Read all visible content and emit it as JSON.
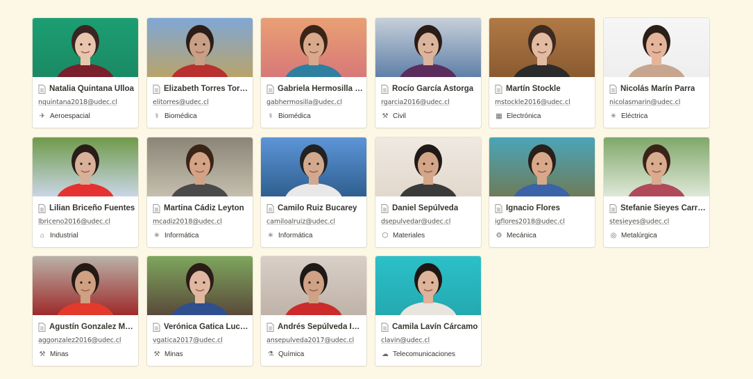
{
  "gallery": {
    "cards": [
      {
        "name": "Natalia Quintana Ulloa",
        "email": "nquintana2018@udec.cl",
        "major": "Aeroespacial",
        "major_icon": "airplane-icon",
        "photo": {
          "bg": "#1d9e72",
          "bg2": "#1a8a64",
          "skin": "#e8c5ad",
          "hair": "#3a2520",
          "shirt": "#7a1f2b"
        }
      },
      {
        "name": "Elizabeth Torres Torres",
        "email": "elitorres@udec.cl",
        "major": "Biomédica",
        "major_icon": "dna-icon",
        "photo": {
          "bg": "#7fa7d6",
          "bg2": "#b9a36a",
          "skin": "#c9a086",
          "hair": "#2a1d18",
          "shirt": "#b8302f"
        }
      },
      {
        "name": "Gabriela Hermosilla Hermosilla",
        "email": "gabhermosilla@udec.cl",
        "major": "Biomédica",
        "major_icon": "dna-icon",
        "photo": {
          "bg": "#e9a074",
          "bg2": "#d87878",
          "skin": "#d9a98c",
          "hair": "#3a2418",
          "shirt": "#2f7fa0"
        }
      },
      {
        "name": "Rocío García Astorga",
        "email": "rgarcia2016@udec.cl",
        "major": "Civil",
        "major_icon": "crane-icon",
        "photo": {
          "bg": "#c7cfd9",
          "bg2": "#5f80a8",
          "skin": "#dbb49c",
          "hair": "#2a1c16",
          "shirt": "#5a2d5c"
        }
      },
      {
        "name": "Martín Stockle",
        "email": "mstockle2016@udec.cl",
        "major": "Electrónica",
        "major_icon": "chip-icon",
        "photo": {
          "bg": "#b07a45",
          "bg2": "#8a5a30",
          "skin": "#e2bba0",
          "hair": "#3d2a20",
          "shirt": "#2b2b2b"
        }
      },
      {
        "name": "Nicolás Marín Parra",
        "email": "nicolasmarin@udec.cl",
        "major": "Eléctrica",
        "major_icon": "spark-icon",
        "photo": {
          "bg": "#f6f6f6",
          "bg2": "#eeeeee",
          "skin": "#e4b59a",
          "hair": "#2a1f1a",
          "shirt": "#c7a58e"
        }
      },
      {
        "name": "Lilian Briceño Fuentes",
        "email": "lbriceno2016@udec.cl",
        "major": "Industrial",
        "major_icon": "factory-icon",
        "photo": {
          "bg": "#6f9a4a",
          "bg2": "#c9d6e6",
          "skin": "#d9b09a",
          "hair": "#2a1c16",
          "shirt": "#e63131"
        }
      },
      {
        "name": "Martina Cádiz Leyton",
        "email": "mcadiz2018@udec.cl",
        "major": "Informática",
        "major_icon": "cpu-icon",
        "photo": {
          "bg": "#8a8578",
          "bg2": "#c6bfae",
          "skin": "#d4a385",
          "hair": "#3a2418",
          "shirt": "#4a4a4a"
        }
      },
      {
        "name": "Camilo Ruiz Bucarey",
        "email": "camiloalruiz@udec.cl",
        "major": "Informática",
        "major_icon": "cpu-icon",
        "photo": {
          "bg": "#5d95d8",
          "bg2": "#2f5f8f",
          "skin": "#d2a98f",
          "hair": "#222222",
          "shirt": "#e8e8e8"
        }
      },
      {
        "name": "Daniel Sepúlveda",
        "email": "dsepulvedar@udec.cl",
        "major": "Materiales",
        "major_icon": "cube-icon",
        "photo": {
          "bg": "#efe9e2",
          "bg2": "#e2d8cc",
          "skin": "#d2a686",
          "hair": "#1f1a18",
          "shirt": "#3a3a3a"
        }
      },
      {
        "name": "Ignacio Flores",
        "email": "igflores2018@udec.cl",
        "major": "Mecánica",
        "major_icon": "wrench-icon",
        "photo": {
          "bg": "#4aa5b8",
          "bg2": "#6d7c5a",
          "skin": "#d8a88a",
          "hair": "#2a1f1a",
          "shirt": "#3a63a8"
        }
      },
      {
        "name": "Stefanie Sieyes Carrasco",
        "email": "stesieyes@udec.cl",
        "major": "Metalúrgica",
        "major_icon": "metal-icon",
        "photo": {
          "bg": "#7fa86a",
          "bg2": "#dfe8d8",
          "skin": "#d9ab8f",
          "hair": "#3a2418",
          "shirt": "#b04a5a"
        }
      },
      {
        "name": "Agustín Gonzalez Medina",
        "email": "aggonzalez2016@udec.cl",
        "major": "Minas",
        "major_icon": "pickaxe-icon",
        "photo": {
          "bg": "#b9b2a8",
          "bg2": "#9e2a2a",
          "skin": "#d0a083",
          "hair": "#241a15",
          "shirt": "#e33a2b"
        }
      },
      {
        "name": "Verónica Gatica Lucero",
        "email": "vgatica2017@udec.cl",
        "major": "Minas",
        "major_icon": "pickaxe-icon",
        "photo": {
          "bg": "#7ea65d",
          "bg2": "#5a4a3a",
          "skin": "#e0b7a0",
          "hair": "#2a1c16",
          "shirt": "#2f4f8f"
        }
      },
      {
        "name": "Andrés Sepúlveda Inostroza",
        "email": "ansepulveda2017@udec.cl",
        "major": "Química",
        "major_icon": "flask-icon",
        "photo": {
          "bg": "#d9cfc8",
          "bg2": "#bfb2a8",
          "skin": "#cfa185",
          "hair": "#1e1916",
          "shirt": "#cc2b2b"
        }
      },
      {
        "name": "Camila Lavín Cárcamo",
        "email": "clavin@udec.cl",
        "major": "Telecomunicaciones",
        "major_icon": "satellite-icon",
        "photo": {
          "bg": "#2cc0c8",
          "bg2": "#24a9b0",
          "skin": "#ddb39a",
          "hair": "#1f1612",
          "shirt": "#e8e4de"
        }
      }
    ]
  }
}
